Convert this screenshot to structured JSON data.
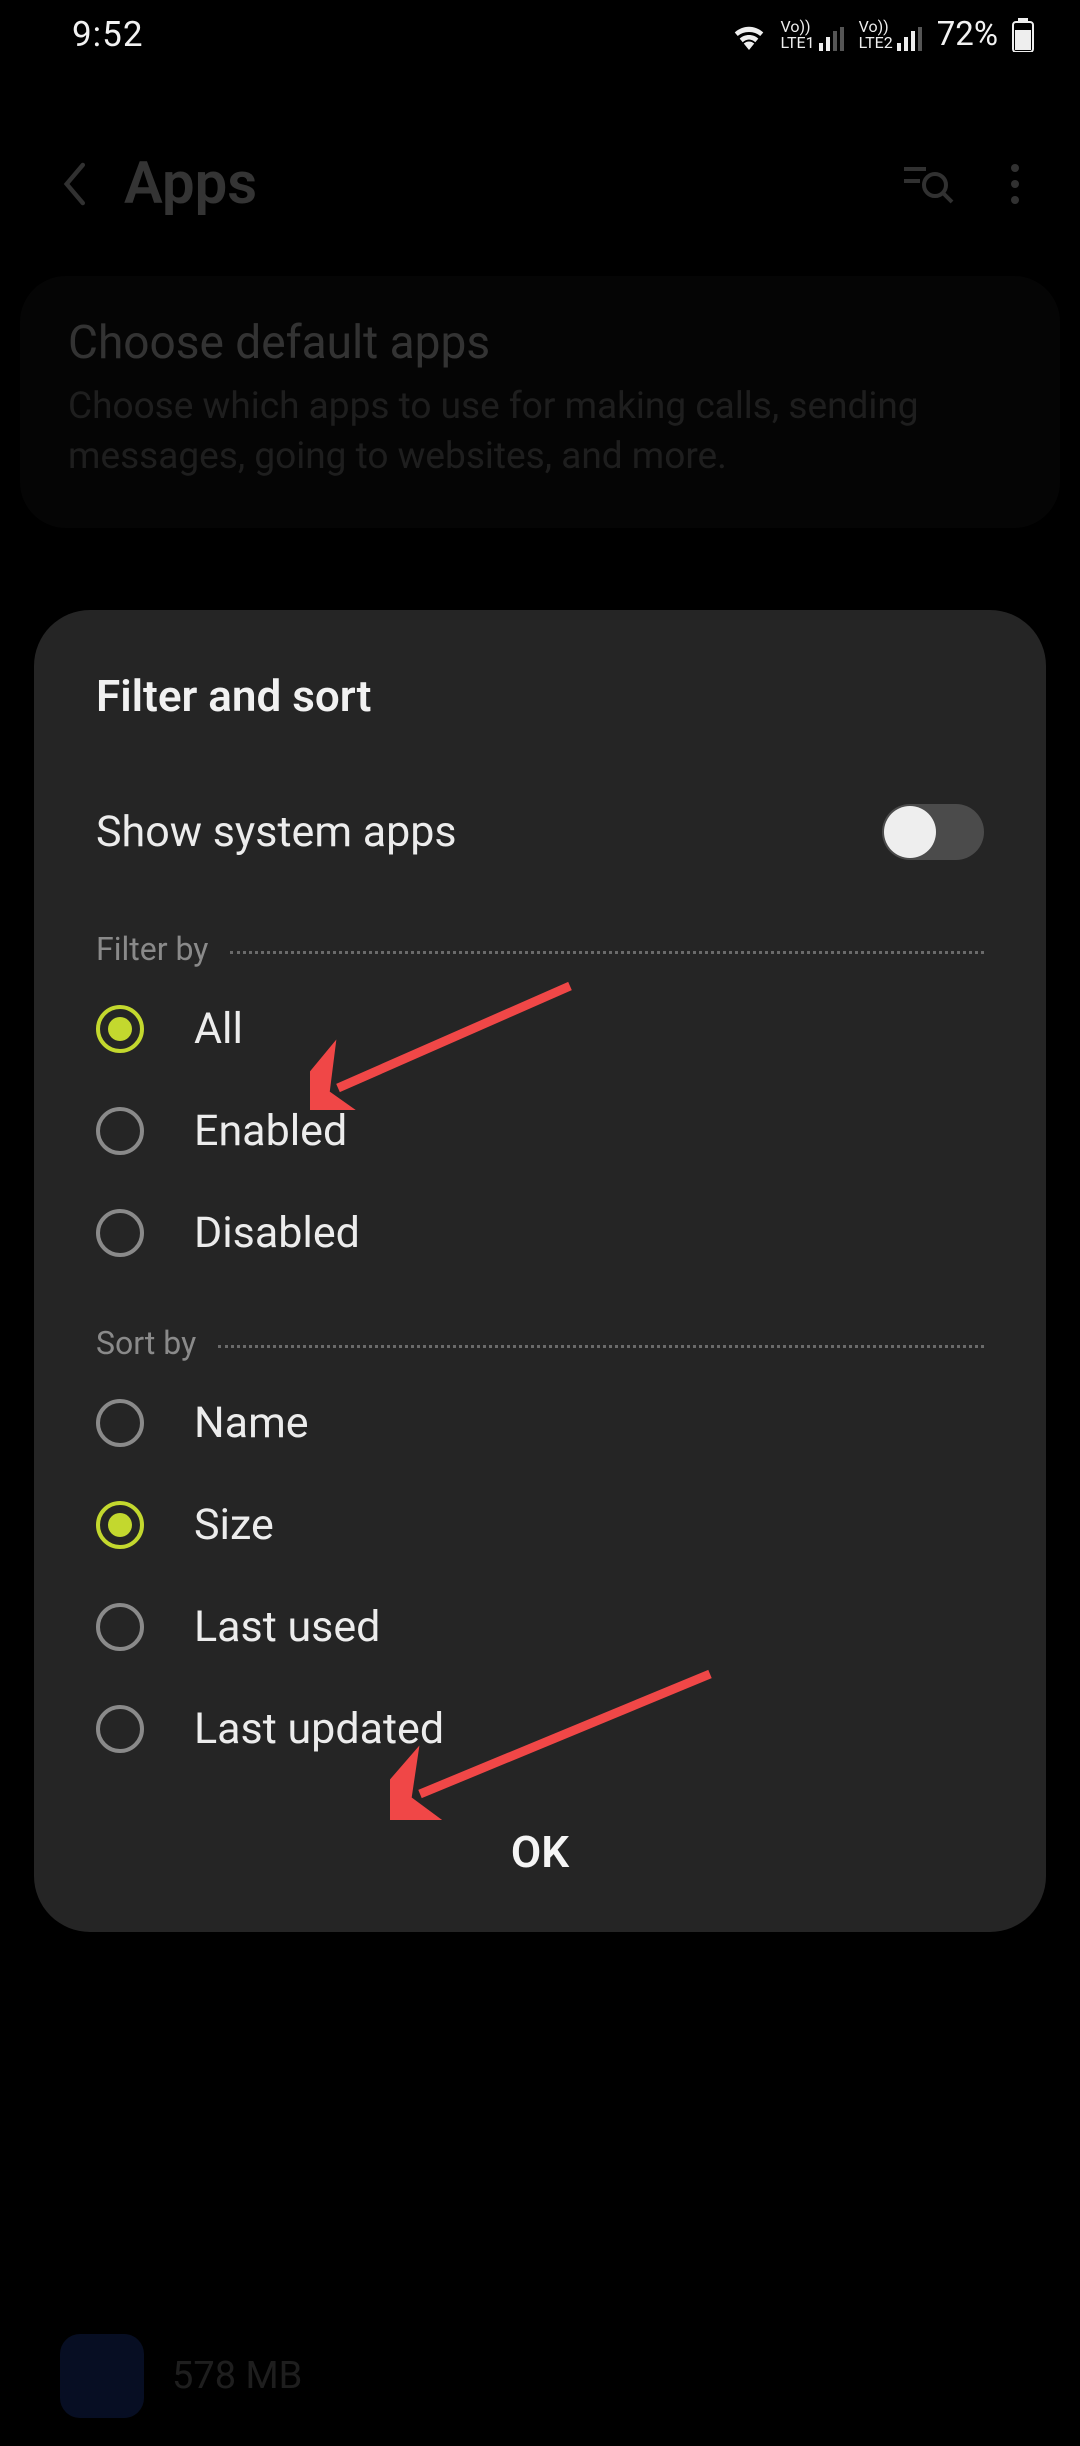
{
  "status": {
    "time": "9:52",
    "battery": "72%",
    "sim1_label": "LTE1",
    "sim2_label": "LTE2"
  },
  "appbar": {
    "title": "Apps"
  },
  "bg_card": {
    "title": "Choose default apps",
    "desc": "Choose which apps to use for making calls, sending messages, going to websites, and more."
  },
  "bg_list_size": "578 MB",
  "dialog": {
    "title": "Filter and sort",
    "show_system": "Show system apps",
    "filter_by_label": "Filter by",
    "sort_by_label": "Sort by",
    "ok": "OK",
    "filter_options": [
      {
        "label": "All",
        "selected": true
      },
      {
        "label": "Enabled",
        "selected": false
      },
      {
        "label": "Disabled",
        "selected": false
      }
    ],
    "sort_options": [
      {
        "label": "Name",
        "selected": false
      },
      {
        "label": "Size",
        "selected": true
      },
      {
        "label": "Last used",
        "selected": false
      },
      {
        "label": "Last updated",
        "selected": false
      }
    ]
  },
  "colors": {
    "accent": "#c3d82e",
    "arrow": "#f04747"
  }
}
